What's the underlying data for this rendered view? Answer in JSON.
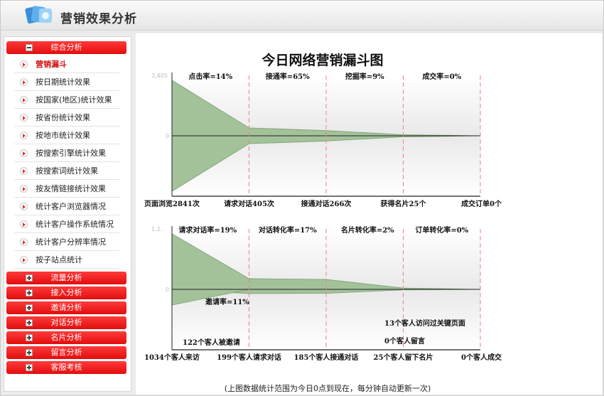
{
  "app": {
    "title": "营销效果分析"
  },
  "sidebar": {
    "groups": [
      {
        "label": "综合分析",
        "expanded": true
      },
      {
        "label": "流量分析"
      },
      {
        "label": "接入分析"
      },
      {
        "label": "邀请分析"
      },
      {
        "label": "对话分析"
      },
      {
        "label": "名片分析"
      },
      {
        "label": "留言分析"
      },
      {
        "label": "客服考核"
      }
    ],
    "items": [
      {
        "label": "营销漏斗",
        "active": true
      },
      {
        "label": "按日期统计效果"
      },
      {
        "label": "按国家(地区)统计效果"
      },
      {
        "label": "按省份统计效果"
      },
      {
        "label": "按地市统计效果"
      },
      {
        "label": "按搜索引擎统计效果"
      },
      {
        "label": "按搜索词统计效果"
      },
      {
        "label": "按友情链接统计效果"
      },
      {
        "label": "统计客户浏览器情况"
      },
      {
        "label": "统计客户操作系统情况"
      },
      {
        "label": "统计客户分辨率情况"
      },
      {
        "label": "按子站点统计"
      }
    ]
  },
  "chart_data": [
    {
      "type": "area",
      "title": "今日网络营销漏斗图",
      "y_tick_top": "3,405",
      "y_tick_mid": "0",
      "stages": [
        {
          "label": "页面浏览2841次",
          "value": 2841
        },
        {
          "label": "请求对话405次",
          "value": 405
        },
        {
          "label": "接通对话266次",
          "value": 266
        },
        {
          "label": "获得名片25个",
          "value": 25
        },
        {
          "label": "成交订单0个",
          "value": 0
        }
      ],
      "rates": [
        "点击率=14%",
        "接通率=65%",
        "挖掘率=9%",
        "成交率=0%"
      ]
    },
    {
      "type": "area",
      "y_tick_top": "1,2..",
      "y_tick_mid": "0",
      "stages": [
        {
          "label": "1034个客人来访",
          "value": 1034
        },
        {
          "label": "199个客人请求对话",
          "value": 199
        },
        {
          "label": "185个客人接通对话",
          "value": 185
        },
        {
          "label": "25个客人留下名片",
          "value": 25
        },
        {
          "label": "0个客人成交",
          "value": 0
        }
      ],
      "rates": [
        "请求对话率=19%",
        "对话转化率=17%",
        "名片转化率=2%",
        "订单转化率=0%"
      ],
      "branch": {
        "rate": "邀请率=11%",
        "label": "122个客人被邀请",
        "value": 122
      },
      "notes": [
        "13个客人访问过关键页面",
        "0个客人留言"
      ]
    }
  ],
  "footnote": "(上图数据统计范围为今日0点到现在，每分钟自动更新一次)",
  "colors": {
    "accent": "#e81515",
    "funnel_fill": "#a3c29a",
    "funnel_stroke": "#7a9e72",
    "grid_dash": "#f08080"
  }
}
